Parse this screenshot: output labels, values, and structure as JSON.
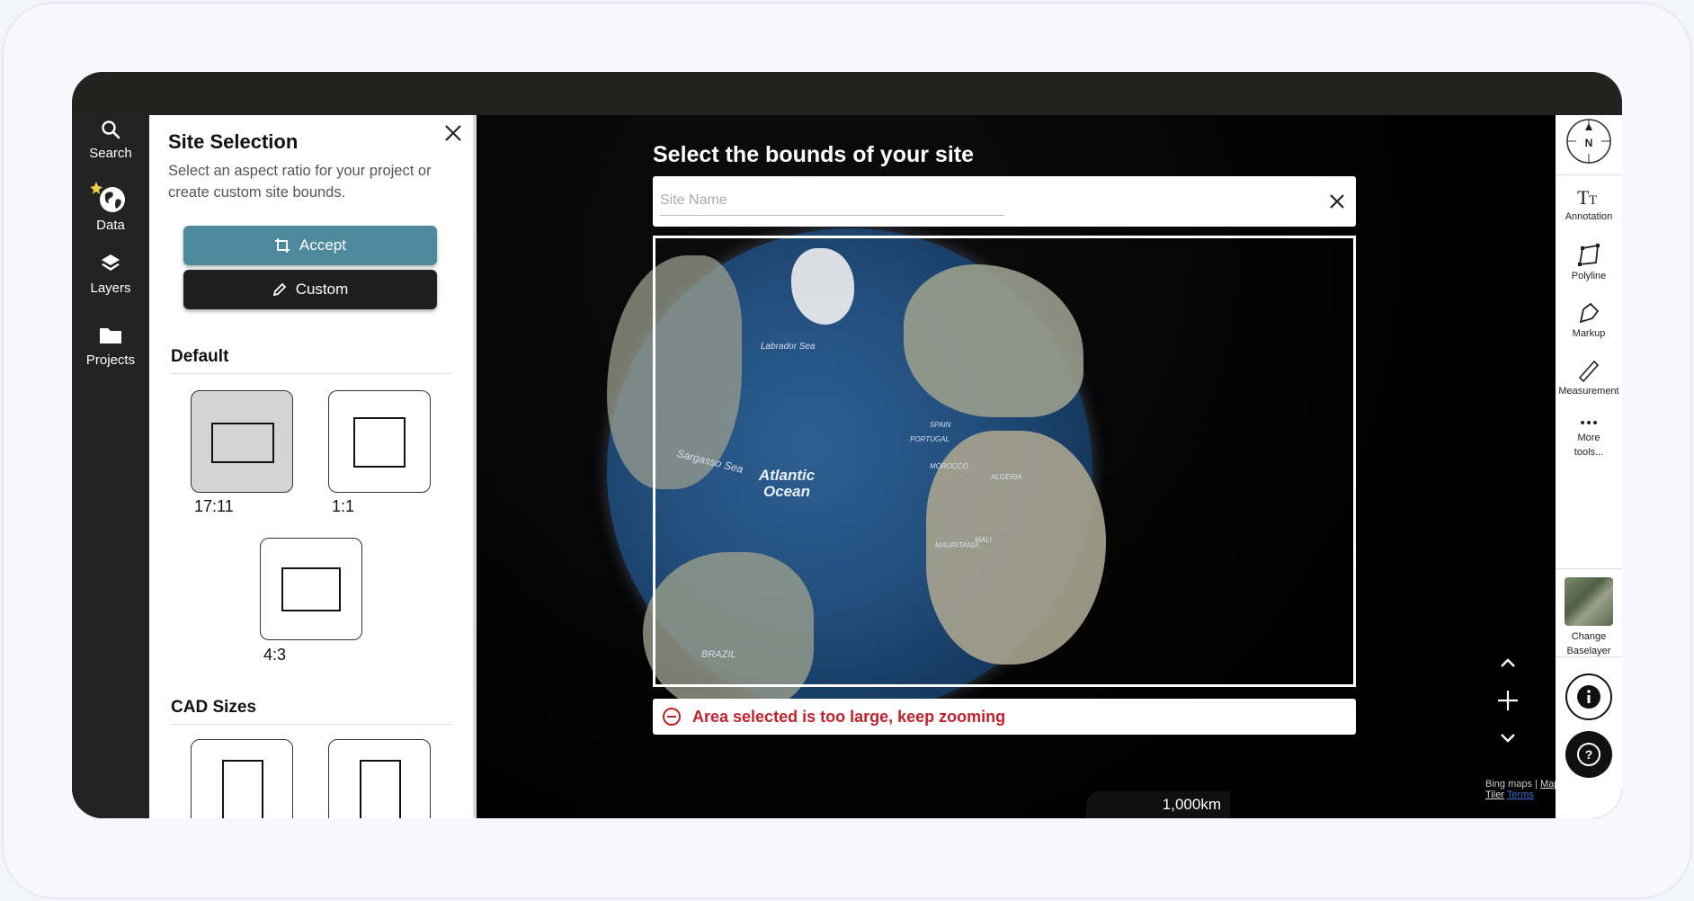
{
  "sidebar_nav": [
    {
      "label": "Search",
      "icon": "search-icon"
    },
    {
      "label": "Data",
      "icon": "globe-icon"
    },
    {
      "label": "Layers",
      "icon": "layers-icon"
    },
    {
      "label": "Projects",
      "icon": "folder-icon"
    }
  ],
  "panel": {
    "title": "Site Selection",
    "description": "Select an aspect ratio for your project or create custom site bounds.",
    "accept_label": "Accept",
    "custom_label": "Custom",
    "default_heading": "Default",
    "ratios": [
      "17:11",
      "1:1",
      "4:3"
    ],
    "selected_ratio": "17:11",
    "cad_heading": "CAD Sizes"
  },
  "map": {
    "heading": "Select the bounds of your site",
    "site_name_placeholder": "Site Name",
    "site_name_value": "",
    "error_text": "Area selected is too large, keep zooming",
    "labels": {
      "labrador": "Labrador Sea",
      "sargasso": "Sargasso Sea",
      "atlantic": "Atlantic Ocean",
      "portugal": "PORTUGAL",
      "morocco": "MOROCCO",
      "spain": "SPAIN",
      "algeria": "ALGERIA",
      "mauritania": "MAURITANIA",
      "mali": "MALI",
      "brazil": "BRAZIL"
    },
    "attribution": {
      "bing": "Bing maps",
      "sep": "|",
      "maptiler": "Map Tiler",
      "terms": "Terms"
    },
    "scale": "1,000km"
  },
  "toolbar": {
    "compass": "N",
    "tools": [
      "Annotation",
      "Polyline",
      "Markup",
      "Measurement",
      "More tools..."
    ],
    "baselayer_label": "Change Baselayer"
  },
  "colors": {
    "accent": "#4e8a9c",
    "dark": "#1f1f1f",
    "error": "#c0212b"
  }
}
